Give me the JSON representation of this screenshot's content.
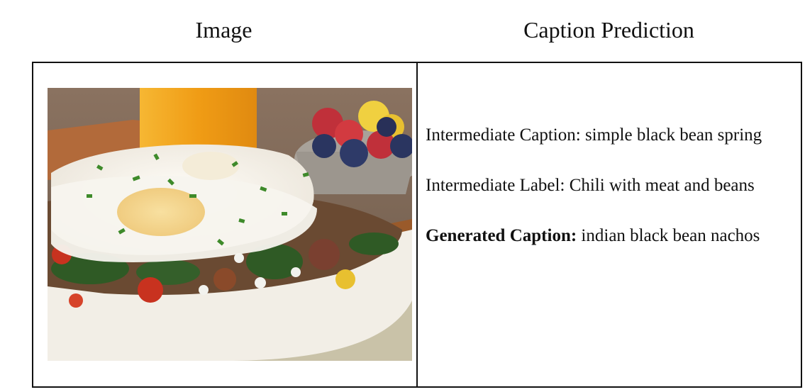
{
  "headers": {
    "image": "Image",
    "caption_prediction": "Caption Prediction"
  },
  "captions": {
    "intermediate_caption_label": "Intermediate Caption:",
    "intermediate_caption_value": "simple black bean spring",
    "intermediate_label_label": "Intermediate Label:",
    "intermediate_label_value": "Chili with meat and beans",
    "generated_caption_label": "Generated Caption:",
    "generated_caption_value": "indian black bean nachos"
  },
  "photo": {
    "icon": "food-photo-icon",
    "colors": {
      "background_wall": "#8a7260",
      "juice": "#f0a020",
      "bowl": "#f2eee6",
      "bowl_rim": "#9a5a2a",
      "egg_white": "#f7f4ee",
      "yolk": "#f5d58a",
      "spinach": "#2f5a25",
      "tomato": "#c8321f",
      "blueberry": "#2a3560",
      "raspberry": "#c0303a"
    }
  }
}
